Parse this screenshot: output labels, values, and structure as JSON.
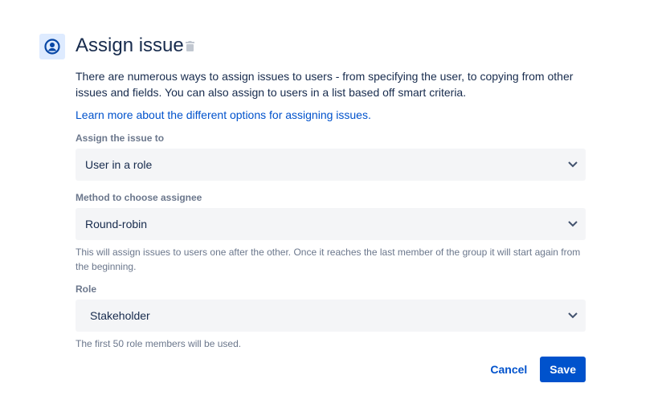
{
  "header": {
    "title": "Assign issue",
    "icon": "user-avatar-icon"
  },
  "description": "There are numerous ways to assign issues to users - from specifying the user, to copying from other issues and fields. You can also assign to users in a list based off smart criteria.",
  "learn_more_link": "Learn more about the different options for assigning issues.",
  "fields": [
    {
      "label": "Assign the issue to",
      "value": "User in a role"
    },
    {
      "label": "Method to choose assignee",
      "value": "Round-robin",
      "help": "This will assign issues to users one after the other. Once it reaches the last member of the group it will start again from the beginning."
    },
    {
      "label": "Role",
      "value": "Stakeholder",
      "help": "The first 50 role members will be used."
    }
  ],
  "actions": {
    "cancel": "Cancel",
    "save": "Save"
  },
  "colors": {
    "primary": "#0052cc",
    "icon_bg": "#deebff"
  }
}
